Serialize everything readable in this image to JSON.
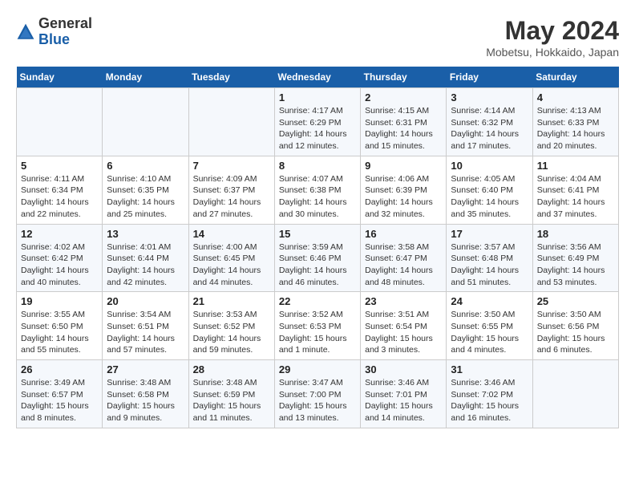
{
  "header": {
    "logo_general": "General",
    "logo_blue": "Blue",
    "month_year": "May 2024",
    "location": "Mobetsu, Hokkaido, Japan"
  },
  "weekdays": [
    "Sunday",
    "Monday",
    "Tuesday",
    "Wednesday",
    "Thursday",
    "Friday",
    "Saturday"
  ],
  "weeks": [
    [
      {
        "day": "",
        "info": ""
      },
      {
        "day": "",
        "info": ""
      },
      {
        "day": "",
        "info": ""
      },
      {
        "day": "1",
        "info": "Sunrise: 4:17 AM\nSunset: 6:29 PM\nDaylight: 14 hours\nand 12 minutes."
      },
      {
        "day": "2",
        "info": "Sunrise: 4:15 AM\nSunset: 6:31 PM\nDaylight: 14 hours\nand 15 minutes."
      },
      {
        "day": "3",
        "info": "Sunrise: 4:14 AM\nSunset: 6:32 PM\nDaylight: 14 hours\nand 17 minutes."
      },
      {
        "day": "4",
        "info": "Sunrise: 4:13 AM\nSunset: 6:33 PM\nDaylight: 14 hours\nand 20 minutes."
      }
    ],
    [
      {
        "day": "5",
        "info": "Sunrise: 4:11 AM\nSunset: 6:34 PM\nDaylight: 14 hours\nand 22 minutes."
      },
      {
        "day": "6",
        "info": "Sunrise: 4:10 AM\nSunset: 6:35 PM\nDaylight: 14 hours\nand 25 minutes."
      },
      {
        "day": "7",
        "info": "Sunrise: 4:09 AM\nSunset: 6:37 PM\nDaylight: 14 hours\nand 27 minutes."
      },
      {
        "day": "8",
        "info": "Sunrise: 4:07 AM\nSunset: 6:38 PM\nDaylight: 14 hours\nand 30 minutes."
      },
      {
        "day": "9",
        "info": "Sunrise: 4:06 AM\nSunset: 6:39 PM\nDaylight: 14 hours\nand 32 minutes."
      },
      {
        "day": "10",
        "info": "Sunrise: 4:05 AM\nSunset: 6:40 PM\nDaylight: 14 hours\nand 35 minutes."
      },
      {
        "day": "11",
        "info": "Sunrise: 4:04 AM\nSunset: 6:41 PM\nDaylight: 14 hours\nand 37 minutes."
      }
    ],
    [
      {
        "day": "12",
        "info": "Sunrise: 4:02 AM\nSunset: 6:42 PM\nDaylight: 14 hours\nand 40 minutes."
      },
      {
        "day": "13",
        "info": "Sunrise: 4:01 AM\nSunset: 6:44 PM\nDaylight: 14 hours\nand 42 minutes."
      },
      {
        "day": "14",
        "info": "Sunrise: 4:00 AM\nSunset: 6:45 PM\nDaylight: 14 hours\nand 44 minutes."
      },
      {
        "day": "15",
        "info": "Sunrise: 3:59 AM\nSunset: 6:46 PM\nDaylight: 14 hours\nand 46 minutes."
      },
      {
        "day": "16",
        "info": "Sunrise: 3:58 AM\nSunset: 6:47 PM\nDaylight: 14 hours\nand 48 minutes."
      },
      {
        "day": "17",
        "info": "Sunrise: 3:57 AM\nSunset: 6:48 PM\nDaylight: 14 hours\nand 51 minutes."
      },
      {
        "day": "18",
        "info": "Sunrise: 3:56 AM\nSunset: 6:49 PM\nDaylight: 14 hours\nand 53 minutes."
      }
    ],
    [
      {
        "day": "19",
        "info": "Sunrise: 3:55 AM\nSunset: 6:50 PM\nDaylight: 14 hours\nand 55 minutes."
      },
      {
        "day": "20",
        "info": "Sunrise: 3:54 AM\nSunset: 6:51 PM\nDaylight: 14 hours\nand 57 minutes."
      },
      {
        "day": "21",
        "info": "Sunrise: 3:53 AM\nSunset: 6:52 PM\nDaylight: 14 hours\nand 59 minutes."
      },
      {
        "day": "22",
        "info": "Sunrise: 3:52 AM\nSunset: 6:53 PM\nDaylight: 15 hours\nand 1 minute."
      },
      {
        "day": "23",
        "info": "Sunrise: 3:51 AM\nSunset: 6:54 PM\nDaylight: 15 hours\nand 3 minutes."
      },
      {
        "day": "24",
        "info": "Sunrise: 3:50 AM\nSunset: 6:55 PM\nDaylight: 15 hours\nand 4 minutes."
      },
      {
        "day": "25",
        "info": "Sunrise: 3:50 AM\nSunset: 6:56 PM\nDaylight: 15 hours\nand 6 minutes."
      }
    ],
    [
      {
        "day": "26",
        "info": "Sunrise: 3:49 AM\nSunset: 6:57 PM\nDaylight: 15 hours\nand 8 minutes."
      },
      {
        "day": "27",
        "info": "Sunrise: 3:48 AM\nSunset: 6:58 PM\nDaylight: 15 hours\nand 9 minutes."
      },
      {
        "day": "28",
        "info": "Sunrise: 3:48 AM\nSunset: 6:59 PM\nDaylight: 15 hours\nand 11 minutes."
      },
      {
        "day": "29",
        "info": "Sunrise: 3:47 AM\nSunset: 7:00 PM\nDaylight: 15 hours\nand 13 minutes."
      },
      {
        "day": "30",
        "info": "Sunrise: 3:46 AM\nSunset: 7:01 PM\nDaylight: 15 hours\nand 14 minutes."
      },
      {
        "day": "31",
        "info": "Sunrise: 3:46 AM\nSunset: 7:02 PM\nDaylight: 15 hours\nand 16 minutes."
      },
      {
        "day": "",
        "info": ""
      }
    ]
  ]
}
